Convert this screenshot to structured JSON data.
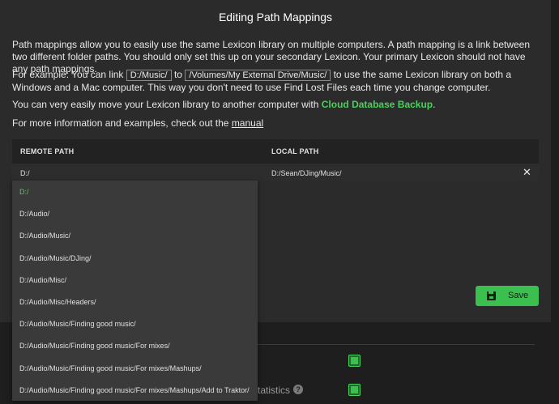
{
  "modal": {
    "title": "Editing Path Mappings",
    "para1": "Path mappings allow you to easily use the same Lexicon library on multiple computers. A path mapping is a link between two different folder paths. You should only set this up on your secondary Lexicon. Your primary Lexicon should not have any path mappings.",
    "para2_prefix": "For example: You can link",
    "para2_code1": "D:/Music/",
    "para2_to": "to",
    "para2_code2": "/Volumes/My External Drive/Music/",
    "para2_suffix": "to use the same Lexicon library on both a Windows and a Mac computer. This way you don't need to use Find Lost Files each time you change computer.",
    "para3_prefix": "You can very easily move your Lexicon library to another computer with",
    "para3_link": "Cloud Database Backup",
    "para3_suffix": ".",
    "para4_prefix": "For more information and examples, check out the",
    "para4_link": "manual"
  },
  "table": {
    "header_remote": "REMOTE PATH",
    "header_local": "LOCAL PATH",
    "row": {
      "remote": "D:/",
      "local": "D:/Sean/DJing/Music/",
      "remove_icon": "✕"
    }
  },
  "dropdown": {
    "options": [
      "D:/",
      "D:/Audio/",
      "D:/Audio/Music/",
      "D:/Audio/Music/DJing/",
      "D:/Audio/Misc/",
      "D:/Audio/Misc/Headers/",
      "D:/Audio/Music/Finding good music/",
      "D:/Audio/Music/Finding good music/For mixes/",
      "D:/Audio/Music/Finding good music/For mixes/Mashups/",
      "D:/Audio/Music/Finding good music/For mixes/Mashups/Add to Traktor/"
    ],
    "selected": "D:/"
  },
  "save_button": {
    "label": "Save",
    "icon": "floppy-disk-icon"
  },
  "background": {
    "setting_label": "tatistics",
    "help_icon": "?"
  },
  "colors": {
    "accent": "#3bbf4f",
    "modal_bg": "#2b2b2b",
    "dropdown_bg": "#3a3a3a"
  }
}
